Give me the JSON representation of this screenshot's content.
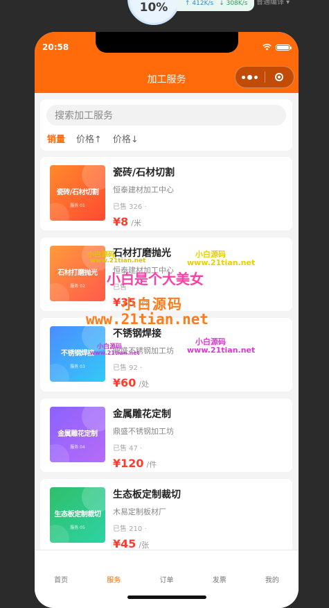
{
  "overlay": {
    "percent": "10%",
    "upload": "↑ 412K/s",
    "download": "↓ 308K/s",
    "menu": "普通编译 ▾"
  },
  "status_bar": {
    "time": "20:58"
  },
  "header": {
    "title": "加工服务"
  },
  "search": {
    "placeholder": "搜索加工服务"
  },
  "sort_tabs": [
    {
      "label": "销量"
    },
    {
      "label": "价格↑"
    },
    {
      "label": "价格↓"
    }
  ],
  "services": [
    {
      "name": "瓷砖/石材切割",
      "thumb_title": "瓷砖/石材切割",
      "thumb_sub": "服务 01",
      "shop": "恒泰建材加工中心",
      "sold": "已售 326 ·",
      "price": "¥8",
      "unit": "/米",
      "gradient": [
        "#ff8a2b",
        "#ff4a32"
      ]
    },
    {
      "name": "石材打磨抛光",
      "thumb_title": "石材打磨抛光",
      "thumb_sub": "服务 02",
      "shop": "恒泰建材加工中心",
      "sold": "已售",
      "price": "¥35",
      "unit": "/件",
      "gradient": [
        "#ff9a3c",
        "#ff5a4a"
      ]
    },
    {
      "name": "不锈钢焊接",
      "thumb_title": "不锈钢焊接",
      "thumb_sub": "服务 03",
      "shop": "鼎盛不锈钢加工坊",
      "sold": "已售 92 ·",
      "price": "¥60",
      "unit": "/处",
      "gradient": [
        "#4a8dff",
        "#35c8f7"
      ]
    },
    {
      "name": "金属雕花定制",
      "thumb_title": "金属雕花定制",
      "thumb_sub": "服务 04",
      "shop": "鼎盛不锈钢加工坊",
      "sold": "已售 47 ·",
      "price": "¥120",
      "unit": "/件",
      "gradient": [
        "#8c62ff",
        "#b56cf7"
      ]
    },
    {
      "name": "生态板定制裁切",
      "thumb_title": "生态板定制裁切",
      "thumb_sub": "服务 05",
      "shop": "木易定制板材厂",
      "sold": "已售 210 ·",
      "price": "¥45",
      "unit": "/张",
      "gradient": [
        "#2fbf6a",
        "#2ed3a4"
      ]
    }
  ],
  "watermark": {
    "a": "小白源码",
    "b": "www.21tian.net",
    "c": "小白是个大美女",
    "d": "小白源码",
    "e": "www.21tian.net",
    "f": "小白源码",
    "g": "www.21tian.net"
  },
  "tabbar": [
    {
      "label": "首页"
    },
    {
      "label": "服务"
    },
    {
      "label": "订单"
    },
    {
      "label": "发票"
    },
    {
      "label": "我的"
    }
  ],
  "colors": {
    "accent": "#ff6a0b",
    "price": "#ff3b2f"
  }
}
